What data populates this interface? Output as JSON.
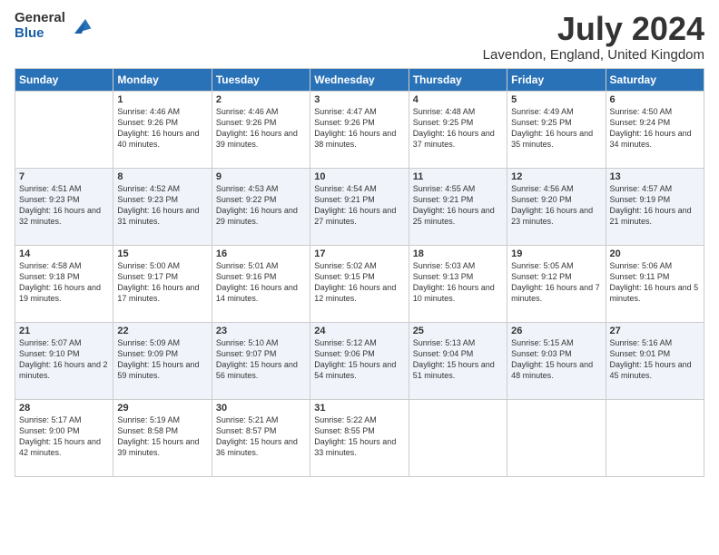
{
  "header": {
    "logo_general": "General",
    "logo_blue": "Blue",
    "month_title": "July 2024",
    "location": "Lavendon, England, United Kingdom"
  },
  "days_of_week": [
    "Sunday",
    "Monday",
    "Tuesday",
    "Wednesday",
    "Thursday",
    "Friday",
    "Saturday"
  ],
  "weeks": [
    [
      {
        "day": "",
        "sunrise": "",
        "sunset": "",
        "daylight": ""
      },
      {
        "day": "1",
        "sunrise": "Sunrise: 4:46 AM",
        "sunset": "Sunset: 9:26 PM",
        "daylight": "Daylight: 16 hours and 40 minutes."
      },
      {
        "day": "2",
        "sunrise": "Sunrise: 4:46 AM",
        "sunset": "Sunset: 9:26 PM",
        "daylight": "Daylight: 16 hours and 39 minutes."
      },
      {
        "day": "3",
        "sunrise": "Sunrise: 4:47 AM",
        "sunset": "Sunset: 9:26 PM",
        "daylight": "Daylight: 16 hours and 38 minutes."
      },
      {
        "day": "4",
        "sunrise": "Sunrise: 4:48 AM",
        "sunset": "Sunset: 9:25 PM",
        "daylight": "Daylight: 16 hours and 37 minutes."
      },
      {
        "day": "5",
        "sunrise": "Sunrise: 4:49 AM",
        "sunset": "Sunset: 9:25 PM",
        "daylight": "Daylight: 16 hours and 35 minutes."
      },
      {
        "day": "6",
        "sunrise": "Sunrise: 4:50 AM",
        "sunset": "Sunset: 9:24 PM",
        "daylight": "Daylight: 16 hours and 34 minutes."
      }
    ],
    [
      {
        "day": "7",
        "sunrise": "Sunrise: 4:51 AM",
        "sunset": "Sunset: 9:23 PM",
        "daylight": "Daylight: 16 hours and 32 minutes."
      },
      {
        "day": "8",
        "sunrise": "Sunrise: 4:52 AM",
        "sunset": "Sunset: 9:23 PM",
        "daylight": "Daylight: 16 hours and 31 minutes."
      },
      {
        "day": "9",
        "sunrise": "Sunrise: 4:53 AM",
        "sunset": "Sunset: 9:22 PM",
        "daylight": "Daylight: 16 hours and 29 minutes."
      },
      {
        "day": "10",
        "sunrise": "Sunrise: 4:54 AM",
        "sunset": "Sunset: 9:21 PM",
        "daylight": "Daylight: 16 hours and 27 minutes."
      },
      {
        "day": "11",
        "sunrise": "Sunrise: 4:55 AM",
        "sunset": "Sunset: 9:21 PM",
        "daylight": "Daylight: 16 hours and 25 minutes."
      },
      {
        "day": "12",
        "sunrise": "Sunrise: 4:56 AM",
        "sunset": "Sunset: 9:20 PM",
        "daylight": "Daylight: 16 hours and 23 minutes."
      },
      {
        "day": "13",
        "sunrise": "Sunrise: 4:57 AM",
        "sunset": "Sunset: 9:19 PM",
        "daylight": "Daylight: 16 hours and 21 minutes."
      }
    ],
    [
      {
        "day": "14",
        "sunrise": "Sunrise: 4:58 AM",
        "sunset": "Sunset: 9:18 PM",
        "daylight": "Daylight: 16 hours and 19 minutes."
      },
      {
        "day": "15",
        "sunrise": "Sunrise: 5:00 AM",
        "sunset": "Sunset: 9:17 PM",
        "daylight": "Daylight: 16 hours and 17 minutes."
      },
      {
        "day": "16",
        "sunrise": "Sunrise: 5:01 AM",
        "sunset": "Sunset: 9:16 PM",
        "daylight": "Daylight: 16 hours and 14 minutes."
      },
      {
        "day": "17",
        "sunrise": "Sunrise: 5:02 AM",
        "sunset": "Sunset: 9:15 PM",
        "daylight": "Daylight: 16 hours and 12 minutes."
      },
      {
        "day": "18",
        "sunrise": "Sunrise: 5:03 AM",
        "sunset": "Sunset: 9:13 PM",
        "daylight": "Daylight: 16 hours and 10 minutes."
      },
      {
        "day": "19",
        "sunrise": "Sunrise: 5:05 AM",
        "sunset": "Sunset: 9:12 PM",
        "daylight": "Daylight: 16 hours and 7 minutes."
      },
      {
        "day": "20",
        "sunrise": "Sunrise: 5:06 AM",
        "sunset": "Sunset: 9:11 PM",
        "daylight": "Daylight: 16 hours and 5 minutes."
      }
    ],
    [
      {
        "day": "21",
        "sunrise": "Sunrise: 5:07 AM",
        "sunset": "Sunset: 9:10 PM",
        "daylight": "Daylight: 16 hours and 2 minutes."
      },
      {
        "day": "22",
        "sunrise": "Sunrise: 5:09 AM",
        "sunset": "Sunset: 9:09 PM",
        "daylight": "Daylight: 15 hours and 59 minutes."
      },
      {
        "day": "23",
        "sunrise": "Sunrise: 5:10 AM",
        "sunset": "Sunset: 9:07 PM",
        "daylight": "Daylight: 15 hours and 56 minutes."
      },
      {
        "day": "24",
        "sunrise": "Sunrise: 5:12 AM",
        "sunset": "Sunset: 9:06 PM",
        "daylight": "Daylight: 15 hours and 54 minutes."
      },
      {
        "day": "25",
        "sunrise": "Sunrise: 5:13 AM",
        "sunset": "Sunset: 9:04 PM",
        "daylight": "Daylight: 15 hours and 51 minutes."
      },
      {
        "day": "26",
        "sunrise": "Sunrise: 5:15 AM",
        "sunset": "Sunset: 9:03 PM",
        "daylight": "Daylight: 15 hours and 48 minutes."
      },
      {
        "day": "27",
        "sunrise": "Sunrise: 5:16 AM",
        "sunset": "Sunset: 9:01 PM",
        "daylight": "Daylight: 15 hours and 45 minutes."
      }
    ],
    [
      {
        "day": "28",
        "sunrise": "Sunrise: 5:17 AM",
        "sunset": "Sunset: 9:00 PM",
        "daylight": "Daylight: 15 hours and 42 minutes."
      },
      {
        "day": "29",
        "sunrise": "Sunrise: 5:19 AM",
        "sunset": "Sunset: 8:58 PM",
        "daylight": "Daylight: 15 hours and 39 minutes."
      },
      {
        "day": "30",
        "sunrise": "Sunrise: 5:21 AM",
        "sunset": "Sunset: 8:57 PM",
        "daylight": "Daylight: 15 hours and 36 minutes."
      },
      {
        "day": "31",
        "sunrise": "Sunrise: 5:22 AM",
        "sunset": "Sunset: 8:55 PM",
        "daylight": "Daylight: 15 hours and 33 minutes."
      },
      {
        "day": "",
        "sunrise": "",
        "sunset": "",
        "daylight": ""
      },
      {
        "day": "",
        "sunrise": "",
        "sunset": "",
        "daylight": ""
      },
      {
        "day": "",
        "sunrise": "",
        "sunset": "",
        "daylight": ""
      }
    ]
  ]
}
